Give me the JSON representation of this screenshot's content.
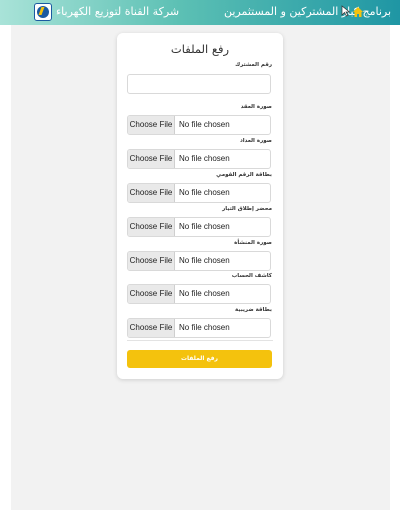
{
  "header": {
    "company_name": "شركة القناة لتوزيع الكهرباء",
    "program_title": "برنامج كبار المشتركين و المستثمرين",
    "home_icon": "home-icon"
  },
  "form": {
    "title": "رفع الملفات",
    "subscriber_label": "رقم المشترك",
    "subscriber_value": "",
    "file_button_label": "Choose File",
    "no_file_text": "No file chosen",
    "file_fields": [
      {
        "label": "صورة العقد"
      },
      {
        "label": "صورة العداد"
      },
      {
        "label": "بطاقة الرقم القومي"
      },
      {
        "label": "محضر إطلاق التيار"
      },
      {
        "label": "صورة المنشأة"
      },
      {
        "label": "كاشف الحساب"
      },
      {
        "label": "بطاقة ضريبية"
      }
    ],
    "submit_label": "رفع الملفات"
  },
  "colors": {
    "header_start": "#a9e3d8",
    "header_end": "#1f96a4",
    "submit": "#f4c20d"
  }
}
